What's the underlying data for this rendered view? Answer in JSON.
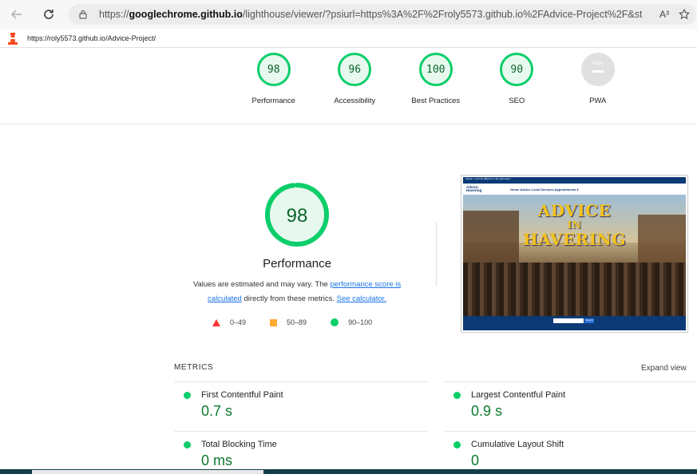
{
  "browser": {
    "url_prefix": "https://",
    "url_domain": "googlechrome.github.io",
    "url_path": "/lighthouse/viewer/?psiurl=https%3A%2F%2Froly5573.github.io%2FAdvice-Project%2F&strategy...",
    "read_aloud_label": "A³"
  },
  "report": {
    "tested_url": "https://roly5573.github.io/Advice-Project/"
  },
  "top_gauges": [
    {
      "score": "98",
      "label": "Performance"
    },
    {
      "score": "96",
      "label": "Accessibility"
    },
    {
      "score": "100",
      "label": "Best Practices"
    },
    {
      "score": "90",
      "label": "SEO"
    },
    {
      "score": "PWA",
      "label": "PWA"
    }
  ],
  "performance": {
    "score": "98",
    "score_value": 98,
    "title": "Performance",
    "desc_text_1": "Values are estimated and may vary. The ",
    "desc_link_1": "performance score is calculated",
    "desc_text_2": " directly from these metrics. ",
    "desc_link_2": "See calculator.",
    "legend": [
      {
        "range": "0–49",
        "color": "#ff3333"
      },
      {
        "range": "50–89",
        "color": "#ffaa33"
      },
      {
        "range": "90–100",
        "color": "#0cce6b"
      }
    ],
    "color": "#0cce6b"
  },
  "thumbnail": {
    "topbar": "Advice - Let's be different in the right ways",
    "brand_line_1": "Advice",
    "brand_line_2": "Havering",
    "nav_links": "Home  Advice  Local Services  Appointments ▾",
    "title_line_1": "ADVICE",
    "title_line_2": "IN",
    "title_line_3": "HAVERING",
    "search_button": "Search"
  },
  "metrics": {
    "heading": "METRICS",
    "expand_label": "Expand view",
    "items": [
      {
        "name": "First Contentful Paint",
        "value": "0.7 s"
      },
      {
        "name": "Largest Contentful Paint",
        "value": "0.9 s"
      },
      {
        "name": "Total Blocking Time",
        "value": "0 ms"
      },
      {
        "name": "Cumulative Layout Shift",
        "value": "0"
      }
    ]
  }
}
